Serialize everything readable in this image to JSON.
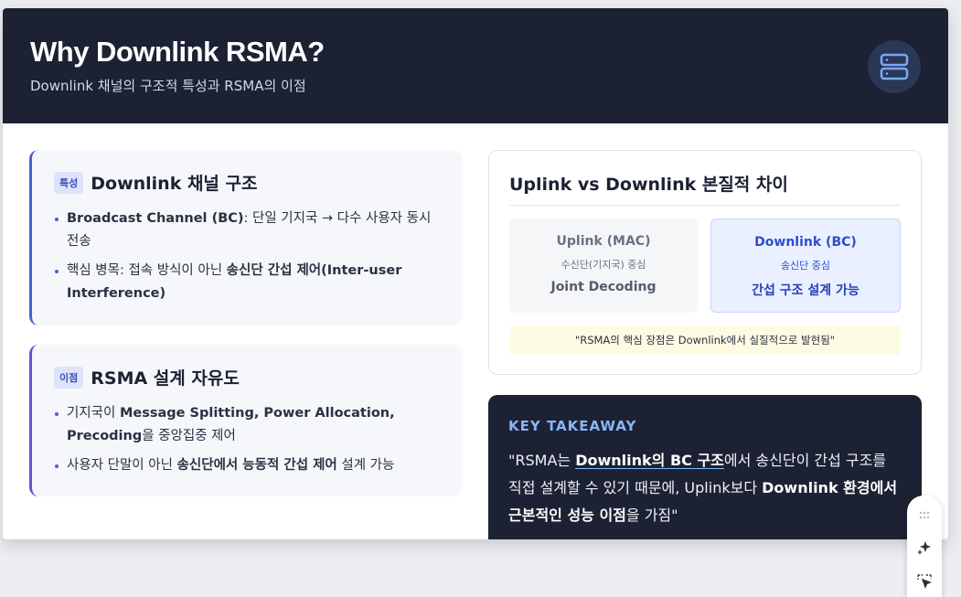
{
  "header": {
    "title": "Why Downlink RSMA?",
    "subtitle": "Downlink 채널의 구조적 특성과 RSMA의 이점",
    "icon": "server-icon"
  },
  "card1": {
    "tag": "특성",
    "title": "Downlink 채널 구조",
    "bullets": [
      {
        "strong": "Broadcast Channel (BC)",
        "rest": ": 단일 기지국 → 다수 사용자 동시 전송"
      },
      {
        "pre": "핵심 병목: 접속 방식이 아닌 ",
        "strong": "송신단 간섭 제어(Inter-user Interference)"
      }
    ]
  },
  "card2": {
    "tag": "이점",
    "title": "RSMA 설계 자유도",
    "bullets": [
      {
        "pre": "기지국이 ",
        "strong": "Message Splitting, Power Allocation, Precoding",
        "rest": "을 중앙집중 제어"
      },
      {
        "pre": "사용자 단말이 아닌 ",
        "strong": "송신단에서 능동적 간섭 제어",
        "rest": " 설계 가능"
      }
    ]
  },
  "comparison": {
    "title": "Uplink vs Downlink 본질적 차이",
    "uplink": {
      "title": "Uplink (MAC)",
      "sub": "수신단(기지국) 중심",
      "body": "Joint Decoding"
    },
    "downlink": {
      "title": "Downlink (BC)",
      "sub": "송신단 중심",
      "body": "간섭 구조 설계 가능"
    },
    "quote": "\"RSMA의 핵심 장점은 Downlink에서 실질적으로 발현됨\""
  },
  "takeaway": {
    "label": "KEY TAKEAWAY",
    "q1": "\"RSMA는 ",
    "q2": "Downlink의 BC 구조",
    "q3": "에서 송신단이 간섭 구조를 직접 설계할 수 있기 때문에, Uplink보다 ",
    "q4": "Downlink 환경에서 근본적인 성능 이점",
    "q5": "을 가짐\""
  },
  "colors": {
    "header_bg": "#1c2233",
    "accent_blue": "#4561d8",
    "accent_purple": "#6a4fd1",
    "takeaway_label": "#8ab4f8"
  }
}
